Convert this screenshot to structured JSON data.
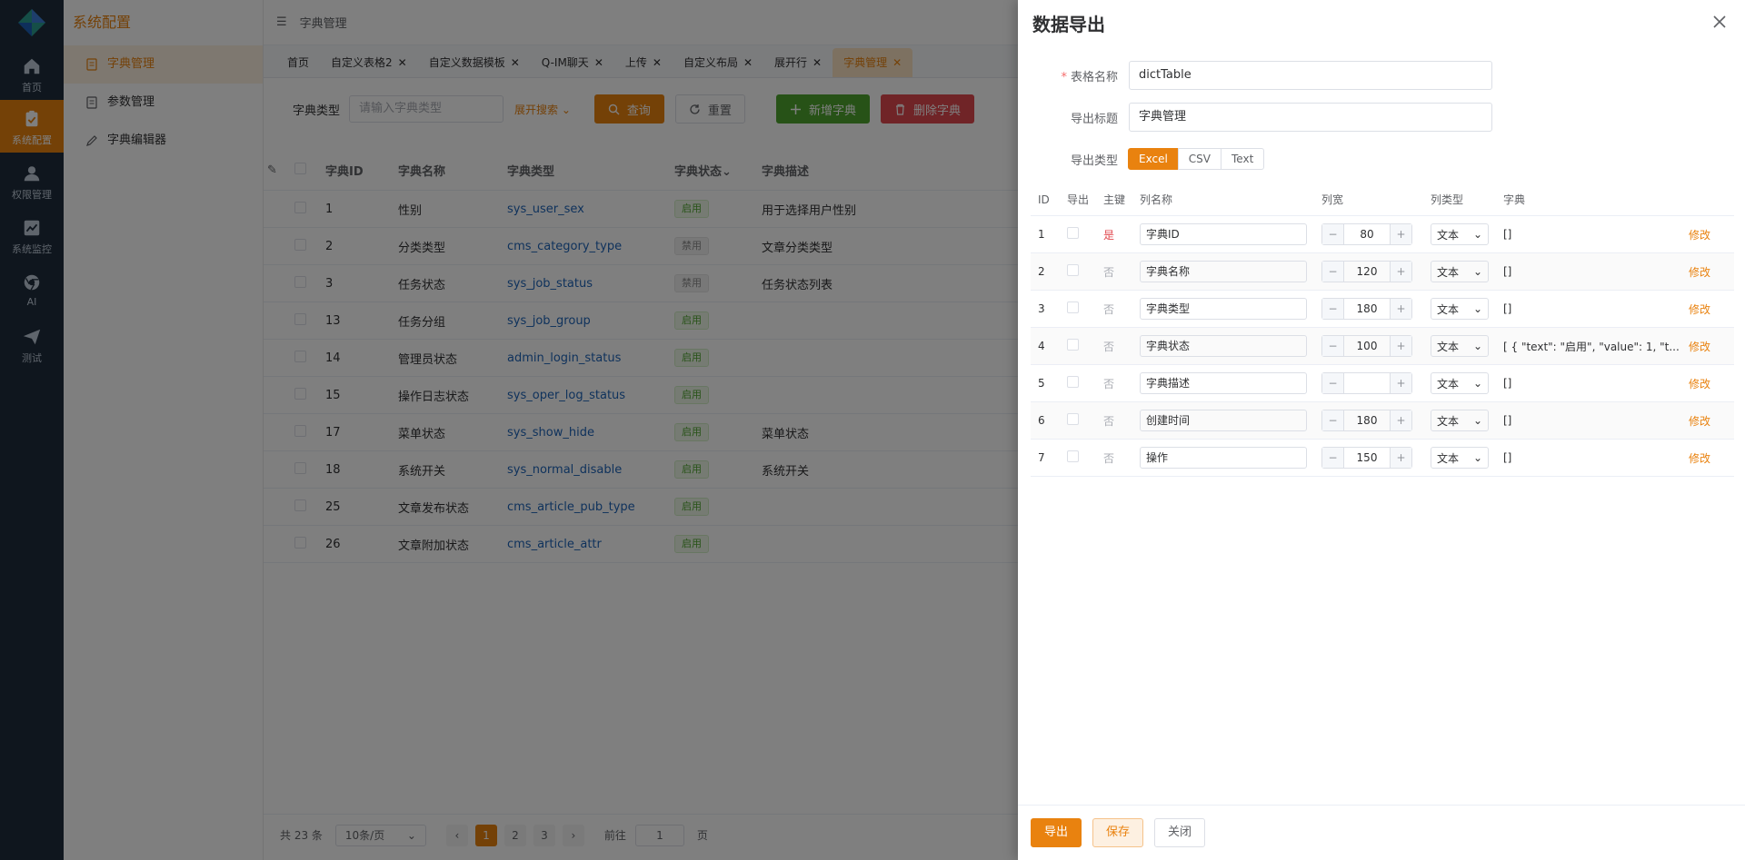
{
  "rail": {
    "items": [
      {
        "label": "首页",
        "icon": "home-icon"
      },
      {
        "label": "系统配置",
        "icon": "clipboard-icon"
      },
      {
        "label": "权限管理",
        "icon": "user-icon"
      },
      {
        "label": "系统监控",
        "icon": "chart-icon"
      },
      {
        "label": "AI",
        "icon": "chrome-icon"
      },
      {
        "label": "测试",
        "icon": "send-icon"
      }
    ]
  },
  "submenu": {
    "title": "系统配置",
    "items": [
      {
        "label": "字典管理",
        "icon": "document-icon"
      },
      {
        "label": "参数管理",
        "icon": "document-icon"
      },
      {
        "label": "字典编辑器",
        "icon": "edit-icon"
      }
    ]
  },
  "topbar": {
    "breadcrumb": "字典管理"
  },
  "tabs": [
    "首页",
    "自定义表格2",
    "自定义数据模板",
    "Q-IM聊天",
    "上传",
    "自定义布局",
    "展开行",
    "字典管理"
  ],
  "filter": {
    "label": "字典类型",
    "placeholder": "请输入字典类型",
    "expand": "展开搜索",
    "query": "查询",
    "reset": "重置",
    "add": "新增字典",
    "delete": "删除字典"
  },
  "table": {
    "headers": [
      "字典ID",
      "字典名称",
      "字典类型",
      "字典状态",
      "字典描述"
    ],
    "rows": [
      {
        "id": "1",
        "name": "性别",
        "type": "sys_user_sex",
        "status": "启用",
        "desc": "用于选择用户性别"
      },
      {
        "id": "2",
        "name": "分类类型",
        "type": "cms_category_type",
        "status": "禁用",
        "desc": "文章分类类型"
      },
      {
        "id": "3",
        "name": "任务状态",
        "type": "sys_job_status",
        "status": "禁用",
        "desc": "任务状态列表"
      },
      {
        "id": "13",
        "name": "任务分组",
        "type": "sys_job_group",
        "status": "启用",
        "desc": ""
      },
      {
        "id": "14",
        "name": "管理员状态",
        "type": "admin_login_status",
        "status": "启用",
        "desc": ""
      },
      {
        "id": "15",
        "name": "操作日志状态",
        "type": "sys_oper_log_status",
        "status": "启用",
        "desc": ""
      },
      {
        "id": "17",
        "name": "菜单状态",
        "type": "sys_show_hide",
        "status": "启用",
        "desc": "菜单状态"
      },
      {
        "id": "18",
        "name": "系统开关",
        "type": "sys_normal_disable",
        "status": "启用",
        "desc": "系统开关"
      },
      {
        "id": "25",
        "name": "文章发布状态",
        "type": "cms_article_pub_type",
        "status": "启用",
        "desc": ""
      },
      {
        "id": "26",
        "name": "文章附加状态",
        "type": "cms_article_attr",
        "status": "启用",
        "desc": ""
      }
    ]
  },
  "pager": {
    "total": "共 23 条",
    "size": "10条/页",
    "pages": [
      "1",
      "2",
      "3"
    ],
    "goto": "前往",
    "goto_value": "1",
    "unit": "页"
  },
  "drawer": {
    "title": "数据导出",
    "table_name_label": "表格名称",
    "table_name": "dictTable",
    "export_title_label": "导出标题",
    "export_title": "字典管理",
    "export_type_label": "导出类型",
    "types": [
      "Excel",
      "CSV",
      "Text"
    ],
    "selected_type": "Excel",
    "headers": [
      "ID",
      "导出",
      "主键",
      "列名称",
      "列宽",
      "列类型",
      "字典"
    ],
    "columns": [
      {
        "id": "1",
        "pk": "是",
        "name": "字典ID",
        "width": "80",
        "type": "文本",
        "dict": "[]",
        "action": "修改"
      },
      {
        "id": "2",
        "pk": "否",
        "name": "字典名称",
        "width": "120",
        "type": "文本",
        "dict": "[]",
        "action": "修改"
      },
      {
        "id": "3",
        "pk": "否",
        "name": "字典类型",
        "width": "180",
        "type": "文本",
        "dict": "[]",
        "action": "修改"
      },
      {
        "id": "4",
        "pk": "否",
        "name": "字典状态",
        "width": "100",
        "type": "文本",
        "dict": "[ { \"text\": \"启用\", \"value\": 1, \"t...",
        "action": "修改"
      },
      {
        "id": "5",
        "pk": "否",
        "name": "字典描述",
        "width": "",
        "type": "文本",
        "dict": "[]",
        "action": "修改"
      },
      {
        "id": "6",
        "pk": "否",
        "name": "创建时间",
        "width": "180",
        "type": "文本",
        "dict": "[]",
        "action": "修改"
      },
      {
        "id": "7",
        "pk": "否",
        "name": "操作",
        "width": "150",
        "type": "文本",
        "dict": "[]",
        "action": "修改"
      }
    ],
    "footer": {
      "export": "导出",
      "save": "保存",
      "close": "关闭"
    }
  },
  "colors": {
    "accent": "#e9820f",
    "rail": "#1f2d3d",
    "success": "#4ea52e",
    "danger": "#e0484e"
  }
}
